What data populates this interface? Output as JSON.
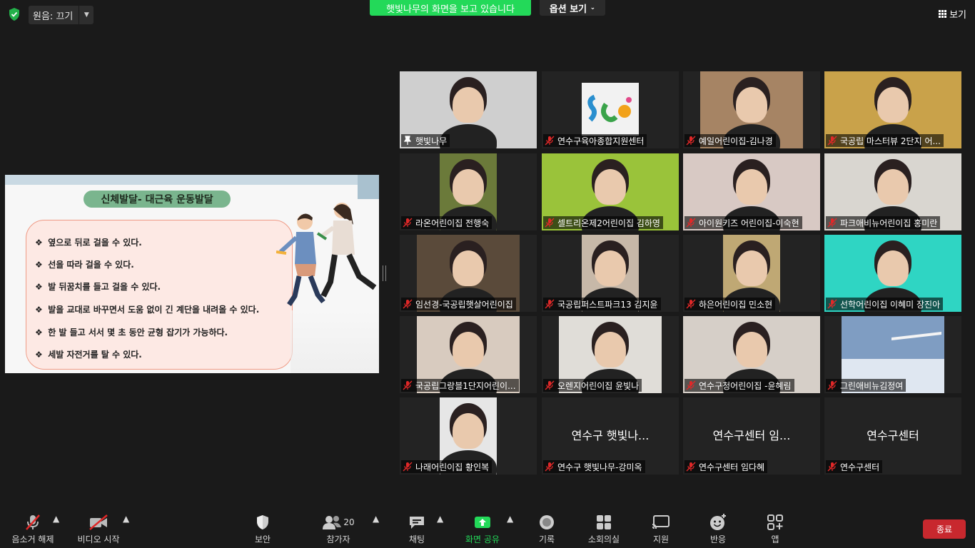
{
  "top": {
    "original_sound": "원음: 끄기",
    "share_banner": "햇빛나무의 화면을 보고 있습니다",
    "view_options": "옵션 보기",
    "view_button": "보기"
  },
  "slide": {
    "title": "신체발달- 대근육 운동발달",
    "bullets": [
      "옆으로 뒤로 걸을 수 있다.",
      "선을 따라 걸을 수 있다.",
      "발 뒤꿈치를 들고 걸을 수 있다.",
      "발을 교대로 바꾸면서 도움 없이 긴 계단을 내려올 수 있다.",
      "한 발 들고 서서 몇 초 동안 균형 잡기가 가능하다.",
      "세발 자전거를 탈 수 있다."
    ],
    "bullet_symbol": "❖"
  },
  "participants": [
    {
      "name": "햇빛나무",
      "pinned": true
    },
    {
      "name": "연수구육아종합지원센터"
    },
    {
      "name": "예일어린이집-김나경"
    },
    {
      "name": "국공립 마스터뷰 2단지 어..."
    },
    {
      "name": "라온어린이집 전행숙"
    },
    {
      "name": "셀트리온제2어린이집 김하영"
    },
    {
      "name": "아이원키즈 어린이집-이숙현"
    },
    {
      "name": "파크애비뉴어린이집 홍미란"
    },
    {
      "name": "임선경-국공립햇살어린이집"
    },
    {
      "name": "국공립퍼스트파크13 김지윤"
    },
    {
      "name": "하은어린이집 민소현"
    },
    {
      "name": "선학어린이집 이혜미 장진아"
    },
    {
      "name": "국공립그랑블1단지어린이..."
    },
    {
      "name": "오렌지어린이집 윤빛나"
    },
    {
      "name": "연수구청어린이집 -윤혜림"
    },
    {
      "name": "그린애비뉴김정여"
    },
    {
      "name": "나래어린이집 황인복"
    },
    {
      "name": "연수구 햇빛나무-강미옥",
      "display": "연수구 햇빛나..."
    },
    {
      "name": "연수구센터 임다혜",
      "display": "연수구센터 임..."
    },
    {
      "name": "연수구센터",
      "display": "연수구센터"
    }
  ],
  "toolbar": {
    "unmute": "음소거 해제",
    "start_video": "비디오 시작",
    "security": "보안",
    "participants": "참가자",
    "participant_count": "20",
    "chat": "채팅",
    "share_screen": "화면 공유",
    "record": "기록",
    "breakout": "소회의실",
    "support": "지원",
    "reactions": "반응",
    "apps": "앱",
    "end": "종료"
  },
  "colors": {
    "share_green": "#23d959",
    "active_speaker": "#e8e46a",
    "end_red": "#c8282e",
    "mic_muted": "#e02828"
  }
}
